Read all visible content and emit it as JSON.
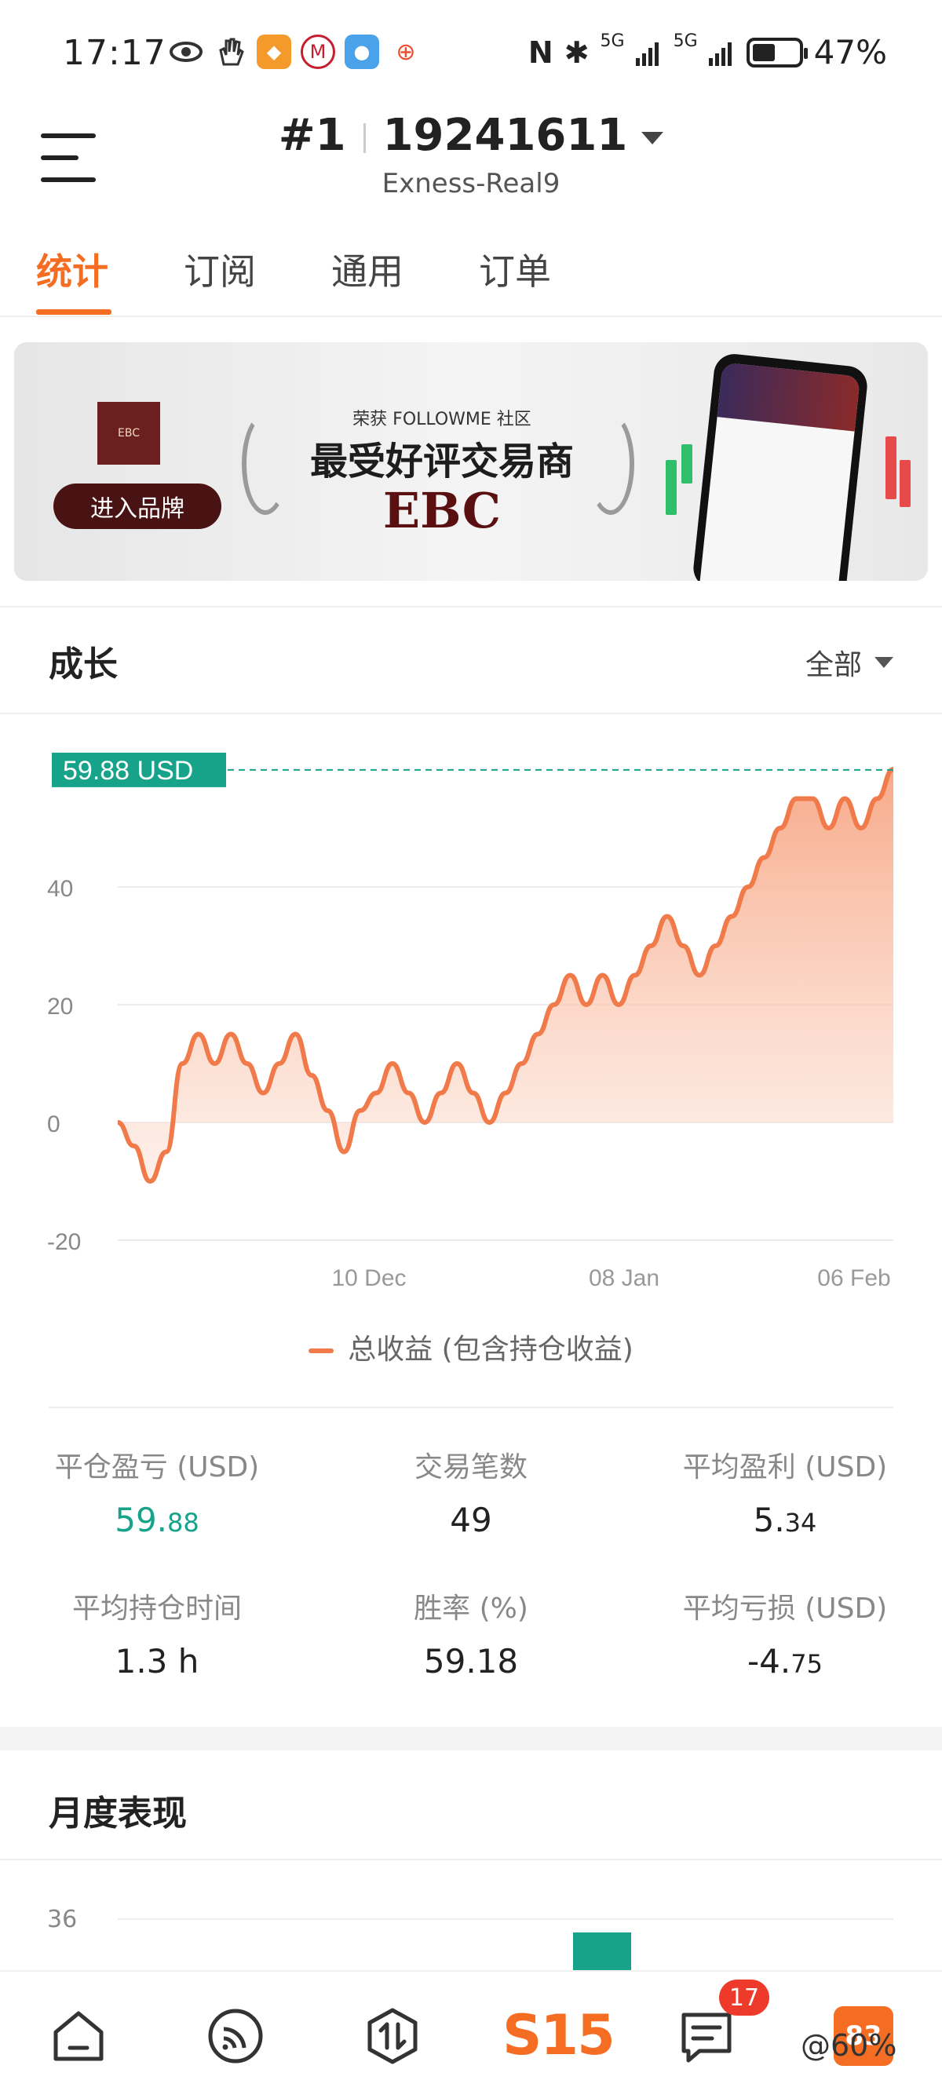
{
  "status_bar": {
    "time": "17:17",
    "network_1": "5G",
    "network_2": "5G",
    "battery": "47%",
    "icons": [
      "eye-icon",
      "hand-icon",
      "app-icon-orange",
      "app-icon-bank",
      "app-icon-weather",
      "app-icon-cart",
      "nfc-icon",
      "bluetooth-icon"
    ]
  },
  "header": {
    "rank": "#1",
    "account_number": "19241611",
    "server": "Exness-Real9"
  },
  "tabs": [
    {
      "label": "统计",
      "active": true
    },
    {
      "label": "订阅",
      "active": false
    },
    {
      "label": "通用",
      "active": false
    },
    {
      "label": "订单",
      "active": false
    }
  ],
  "banner": {
    "enter_button": "进入品牌",
    "award_subtitle": "荣获 FOLLOWME 社区",
    "award_title": "最受好评交易商",
    "brand": "EBC"
  },
  "growth": {
    "title": "成长",
    "range": "全部",
    "current_label": "59.88 USD",
    "legend": "总收益 (包含持仓收益)"
  },
  "chart_data": {
    "type": "area",
    "series": [
      {
        "name": "总收益 (包含持仓收益)",
        "color": "#f07a4a",
        "values": [
          0,
          -4,
          -10,
          -5,
          10,
          15,
          10,
          15,
          10,
          5,
          10,
          15,
          8,
          2,
          -5,
          2,
          5,
          10,
          5,
          0,
          5,
          10,
          5,
          0,
          5,
          10,
          15,
          20,
          25,
          20,
          25,
          20,
          25,
          30,
          35,
          30,
          25,
          30,
          35,
          40,
          45,
          50,
          55,
          55,
          50,
          55,
          50,
          55,
          60
        ]
      }
    ],
    "x_tick_labels": [
      "10 Dec",
      "08 Jan",
      "06 Feb"
    ],
    "y_ticks": [
      -20,
      0,
      20,
      40
    ],
    "ylim": [
      -20,
      60
    ],
    "last_value": 59.88,
    "grid": true
  },
  "stats": [
    {
      "label": "平仓盈亏 (USD)",
      "value_main": "59.",
      "value_small": "88",
      "color": "green"
    },
    {
      "label": "交易笔数",
      "value_main": "49",
      "value_small": "",
      "color": "default"
    },
    {
      "label": "平均盈利 (USD)",
      "value_main": "5.",
      "value_small": "34",
      "color": "default"
    },
    {
      "label": "平均持仓时间",
      "value_main": "1.3 h",
      "value_small": "",
      "color": "default"
    },
    {
      "label": "胜率 (%)",
      "value_main": "59.18",
      "value_small": "",
      "color": "default"
    },
    {
      "label": "平均亏损 (USD)",
      "value_main": "-4.",
      "value_small": "75",
      "color": "default"
    }
  ],
  "monthly": {
    "title": "月度表现",
    "y_tick": "36"
  },
  "bottom_nav": {
    "items": [
      "home-icon",
      "feed-icon",
      "trade-icon",
      "s15-icon",
      "messages-icon",
      "avatar"
    ],
    "s15_label": "S15",
    "message_badge": "17",
    "avatar_text": "83"
  },
  "watermark": "@60%"
}
